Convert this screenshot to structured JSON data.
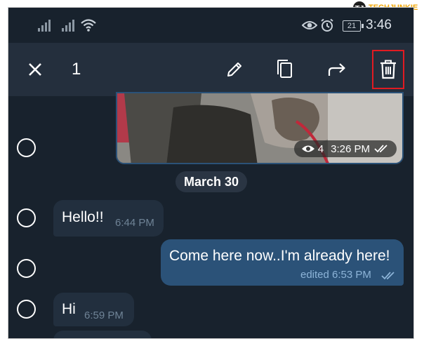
{
  "brand": {
    "logo_text": "TECHJUNKIE"
  },
  "status_bar": {
    "time": "3:46",
    "battery_level": "21"
  },
  "toolbar": {
    "selected_count": "1"
  },
  "photo_message": {
    "views": "4",
    "time": "3:26 PM"
  },
  "date_separator": "March 30",
  "messages": [
    {
      "text": "Hello!!",
      "time": "6:44 PM",
      "direction": "in"
    },
    {
      "text": "Come here now..I'm already here!",
      "time": "edited 6:53 PM",
      "direction": "out"
    },
    {
      "text": "Hi",
      "time": "6:59 PM",
      "direction": "in"
    }
  ],
  "colors": {
    "background": "#18222d",
    "toolbar": "#242f3d",
    "outgoing": "#2b5278",
    "incoming": "#222f3e",
    "highlight": "#e11b22"
  }
}
